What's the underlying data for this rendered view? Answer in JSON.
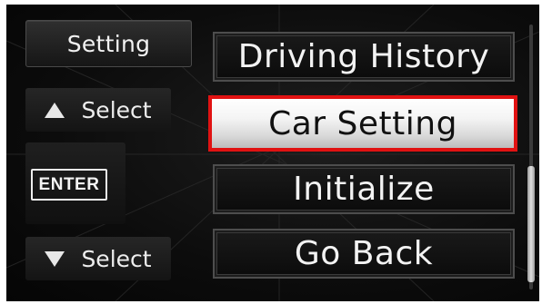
{
  "panel": {
    "title": "Setting"
  },
  "controls": {
    "up_label": "Select",
    "enter_label": "ENTER",
    "down_label": "Select"
  },
  "menu": {
    "items": [
      {
        "label": "Driving History",
        "selected": false
      },
      {
        "label": "Car Setting",
        "selected": true
      },
      {
        "label": "Initialize",
        "selected": false
      },
      {
        "label": "Go Back",
        "selected": false
      }
    ]
  },
  "scrollbar": {
    "position_fraction": 0.55
  },
  "colors": {
    "highlight_border": "#e01212",
    "background": "#0c0c0c",
    "text": "#f3f3f3"
  }
}
